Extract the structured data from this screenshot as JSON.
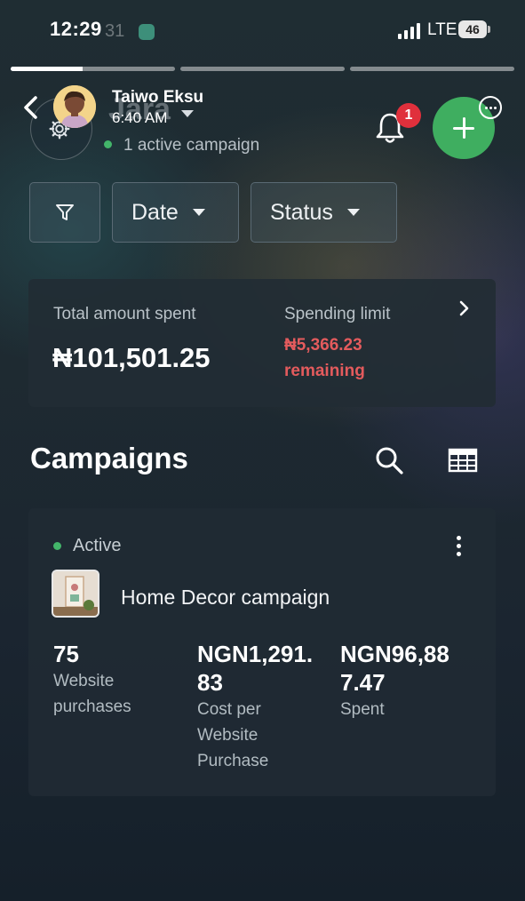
{
  "status_bar": {
    "time": "12:29",
    "time_ghost": "31",
    "network": "LTE",
    "battery": "46"
  },
  "story": {
    "progress": [
      1,
      0,
      0
    ],
    "progress_first_fill": 0.44,
    "account_name": "Taiwo Eksu",
    "posted_time": "6:40 AM"
  },
  "header": {
    "account_title": "Jara",
    "active_campaigns": "1 active campaign",
    "notification_count": "1"
  },
  "filters": {
    "date_label": "Date",
    "status_label": "Status"
  },
  "spend": {
    "total_label": "Total amount spent",
    "total_value": "₦101,501.25",
    "limit_label": "Spending limit",
    "limit_remaining_value": "₦5,366.23",
    "limit_remaining_suffix": "remaining"
  },
  "campaigns": {
    "title": "Campaigns",
    "items": [
      {
        "status": "Active",
        "name": "Home Decor campaign",
        "metrics": [
          {
            "value_lines": [
              "75"
            ],
            "label_lines": [
              "Website",
              "purchases"
            ]
          },
          {
            "value_lines": [
              "NGN1,291.",
              "83"
            ],
            "label_lines": [
              "Cost per",
              "Website",
              "Purchase"
            ]
          },
          {
            "value_lines": [
              "NGN96,88",
              "7.47"
            ],
            "label_lines": [
              "Spent"
            ]
          }
        ]
      }
    ]
  },
  "colors": {
    "accent_green": "#3fae60",
    "status_green": "#43b56a",
    "alert_red": "#e45b5d",
    "badge_red": "#e0303c"
  }
}
